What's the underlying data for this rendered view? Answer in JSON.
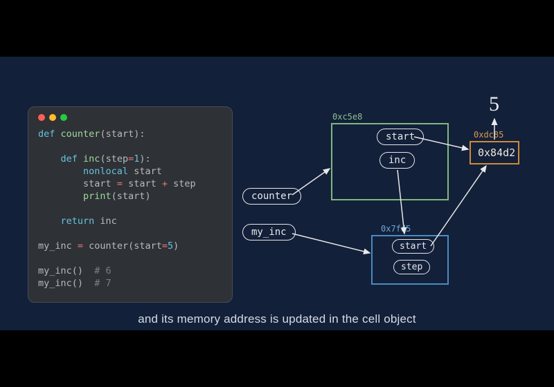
{
  "caption": "and its memory address is updated in the cell object",
  "code": {
    "l1_kw": "def",
    "l1_fn": "counter",
    "l1_rest": "(start):",
    "l3_kw": "def",
    "l3_fn": "inc",
    "l3_rest": "(step",
    "l3_op": "=",
    "l3_num": "1",
    "l3_tail": "):",
    "l4": "nonlocal",
    "l4_rest": " start",
    "l5_a": "start ",
    "l5_op1": "=",
    "l5_b": " start ",
    "l5_op2": "+",
    "l5_c": " step",
    "l6_fn": "print",
    "l6_rest": "(start)",
    "l8_kw": "return",
    "l8_rest": " inc",
    "l10_a": "my_inc ",
    "l10_op": "=",
    "l10_b": " counter(start",
    "l10_op2": "=",
    "l10_num": "5",
    "l10_tail": ")",
    "l12_a": "my_inc()  ",
    "l12_cm": "# 6",
    "l13_a": "my_inc()  ",
    "l13_cm": "# 7"
  },
  "diagram": {
    "counter_label": "counter",
    "my_inc_label": "my_inc",
    "outer_addr": "0xc5e8",
    "outer_start": "start",
    "outer_inc": "inc",
    "inner_addr": "0x7fd5",
    "inner_start": "start",
    "inner_step": "step",
    "cell_addr": "0xdc85",
    "cell_value": "0x84d2",
    "output_value": "5"
  }
}
